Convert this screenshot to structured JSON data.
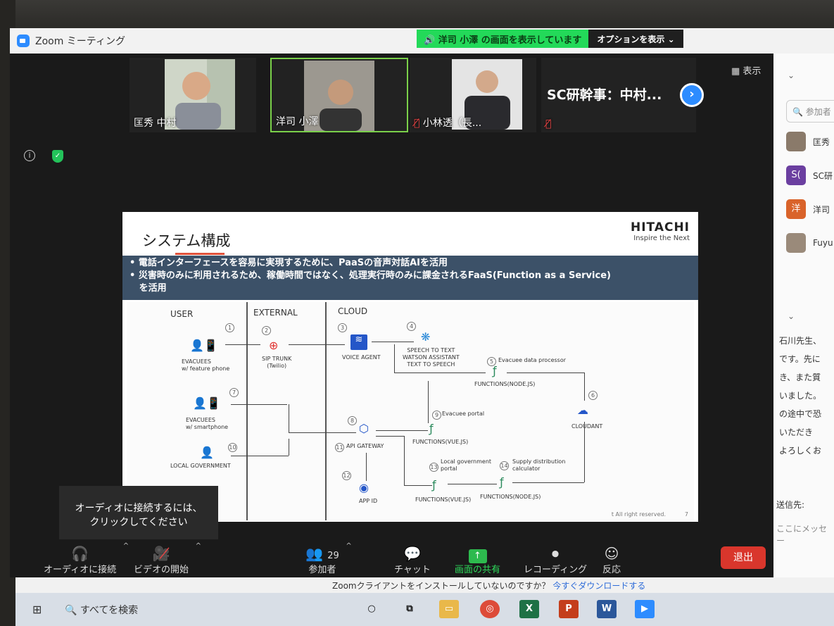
{
  "window": {
    "title": "Zoom ミーティング"
  },
  "share_banner": {
    "text": "洋司 小澤 の画面を表示しています",
    "options": "オプションを表示 ⌄"
  },
  "view_label": "表示",
  "participants_strip": [
    {
      "name": "匡秀 中村"
    },
    {
      "name": "洋司 小澤"
    },
    {
      "name": "小林透（長..."
    },
    {
      "name": "SC研幹事：中村..."
    }
  ],
  "slide": {
    "title": "システム構成",
    "brand": "HITACHI",
    "brand_tagline": "Inspire the Next",
    "bullets": [
      "• 電話インターフェースを容易に実現するために、PaaSの音声対話AIを活用",
      "• 災害時のみに利用されるため、稼働時間ではなく、処理実行時のみに課金されるFaaS(Function as a Service)",
      "   を活用"
    ],
    "columns": [
      "USER",
      "EXTERNAL",
      "CLOUD"
    ],
    "nodes": {
      "evacuees_phone": "EVACUEES\nw/ feature phone",
      "evacuees_smart": "EVACUEES\nw/ smartphone",
      "local_gov": "LOCAL GOVERNMENT",
      "sip": "SIP TRUNK\n(Twilio)",
      "voice_agent": "VOICE AGENT",
      "speech": "SPEECH TO TEXT\nWATSON ASSISTANT\nTEXT TO SPEECH",
      "processor": "Evacuee data processor",
      "functions_node_1": "FUNCTIONS(NODE.JS)",
      "cloudant": "CLOUDANT",
      "portal": "Evacuee portal",
      "functions_vue_1": "FUNCTIONS(VUE.JS)",
      "api_gateway": "API GATEWAY",
      "app_id": "APP ID",
      "lg_portal": "Local government\nportal",
      "functions_vue_2": "FUNCTIONS(VUE.JS)",
      "supply": "Supply distribution\ncalculator",
      "functions_node_2": "FUNCTIONS(NODE.JS)"
    },
    "steps": [
      "1",
      "2",
      "3",
      "4",
      "5",
      "6",
      "7",
      "8",
      "9",
      "10",
      "11",
      "12",
      "13",
      "14"
    ],
    "copyright": "t All right reserved.",
    "page_number": "7"
  },
  "tooltip": "オーディオに接続するには、\nクリックしてください",
  "toolbar": {
    "audio": "オーディオに接続",
    "video": "ビデオの開始",
    "participants": "参加者",
    "participants_count": "29",
    "chat": "チャット",
    "share": "画面の共有",
    "record": "レコーディング",
    "reactions": "反応",
    "leave": "退出"
  },
  "panel": {
    "search_placeholder": "参加者",
    "participants": [
      {
        "initial": "",
        "name": "匡秀",
        "color": "#8a7a6a"
      },
      {
        "initial": "S(",
        "name": "SC研",
        "color": "#6b3fa0"
      },
      {
        "initial": "洋",
        "name": "洋司",
        "color": "#d9632a"
      },
      {
        "initial": "",
        "name": "Fuyu",
        "color": "#9a8a7a"
      }
    ],
    "chat_lines": [
      "石川先生、",
      "です。先に",
      "き、また質",
      "いました。",
      "の途中で恐",
      "いただき",
      "よろしくお"
    ],
    "send_to": "送信先:",
    "message_placeholder": "ここにメッセー"
  },
  "download_bar": {
    "text": "Zoomクライアントをインストールしていないのですか？",
    "link": "今すぐダウンロードする"
  },
  "taskbar": {
    "search": "すべてを検索"
  }
}
